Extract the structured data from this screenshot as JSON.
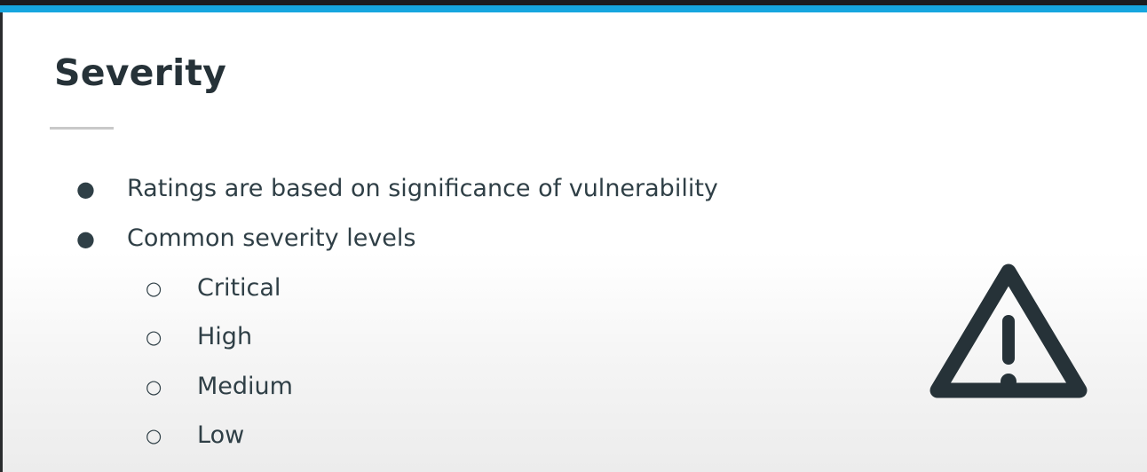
{
  "slide": {
    "title": "Severity",
    "bullets": [
      {
        "text": "Ratings are based on significance of vulnerability",
        "marker": "●"
      },
      {
        "text": "Common severity levels",
        "marker": "●"
      }
    ],
    "sub_bullets": [
      {
        "text": "Critical",
        "marker": "○"
      },
      {
        "text": "High",
        "marker": "○"
      },
      {
        "text": "Medium",
        "marker": "○"
      },
      {
        "text": "Low",
        "marker": "○"
      }
    ],
    "icon": "warning-triangle-icon"
  },
  "colors": {
    "accent": "#16a6df",
    "title": "#263238",
    "text": "#2f3f46"
  }
}
